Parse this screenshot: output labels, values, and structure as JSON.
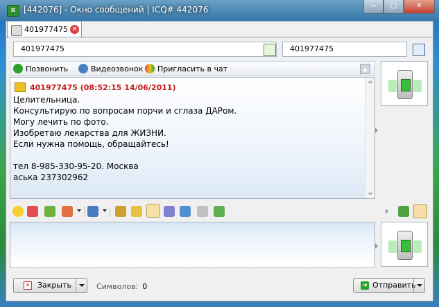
{
  "window": {
    "title": "[442076] - Окно сообщений | ICQ# 442076",
    "icon": "message-window-icon"
  },
  "tab": {
    "label": "401977475",
    "close_icon": "close-icon"
  },
  "contact_fields": {
    "left_value": "401977475",
    "right_value": "401977475"
  },
  "toolbar": {
    "call_label": "Позвонить",
    "video_label": "Видеозвонок",
    "invite_label": "Пригласить в чат"
  },
  "history": {
    "sender_header": "401977475 (08:52:15 14/06/2011)",
    "message": "Целительница.\nКонсультирую по вопросам порчи и сглаза ДАРом.\nМогу лечить по фото.\nИзобретаю лекарства для ЖИЗНИ.\nЕсли нужна помощь, обращайтесь!\n\nтел 8-985-330-95-20. Москва\nаська 237302962"
  },
  "footer": {
    "close_label": "Закрыть",
    "symbols_label": "Символов:",
    "symbols_count": "0",
    "send_label": "Отправить"
  },
  "colors": {
    "sender_header": "#c81818",
    "accent_green": "#39c039"
  }
}
